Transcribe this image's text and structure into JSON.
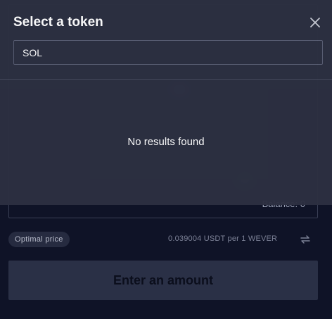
{
  "modal": {
    "title": "Select a token",
    "search_value": "SOL",
    "search_placeholder": "",
    "empty_message": "No results found",
    "close_icon": "close-icon"
  },
  "background": {
    "balance_text": "Balance: 0",
    "optimal_badge": "Optimal price",
    "rate_text": "0.039004 USDT per 1 WEVER",
    "rate_icon": "swap-arrows-icon",
    "enter_amount_label": "Enter an amount"
  },
  "colors": {
    "page_bg": "#0f1327",
    "modal_bg": "#2c3041",
    "button_bg": "#2a3046",
    "badge_bg": "#262b40"
  }
}
